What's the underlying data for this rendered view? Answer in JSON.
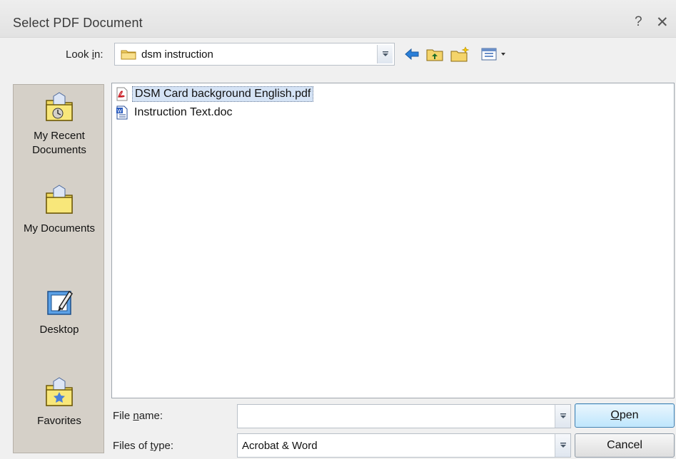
{
  "window": {
    "title": "Select PDF Document",
    "help_glyph": "?",
    "close_glyph": "✕"
  },
  "lookin": {
    "label": "Look in:",
    "value": "dsm instruction"
  },
  "places": [
    {
      "line1": "My Recent",
      "line2": "Documents",
      "icon": "recent-documents-icon"
    },
    {
      "line1": "My Documents",
      "line2": "",
      "icon": "my-documents-icon"
    },
    {
      "line1": "Desktop",
      "line2": "",
      "icon": "desktop-icon"
    },
    {
      "line1": "Favorites",
      "line2": "",
      "icon": "favorites-icon"
    }
  ],
  "files": [
    {
      "name": "DSM Card background English.pdf",
      "type": "pdf",
      "selected": true
    },
    {
      "name": "Instruction Text.doc",
      "type": "doc",
      "selected": false
    }
  ],
  "filename": {
    "label": "File name:",
    "value": ""
  },
  "filetype": {
    "label": "Files of type:",
    "value": "Acrobat & Word"
  },
  "buttons": {
    "open": "Open",
    "cancel": "Cancel"
  },
  "colors": {
    "places_bg": "#d5d0c8",
    "selection": "#d5e3f5",
    "default_button": "#bee6fd"
  }
}
